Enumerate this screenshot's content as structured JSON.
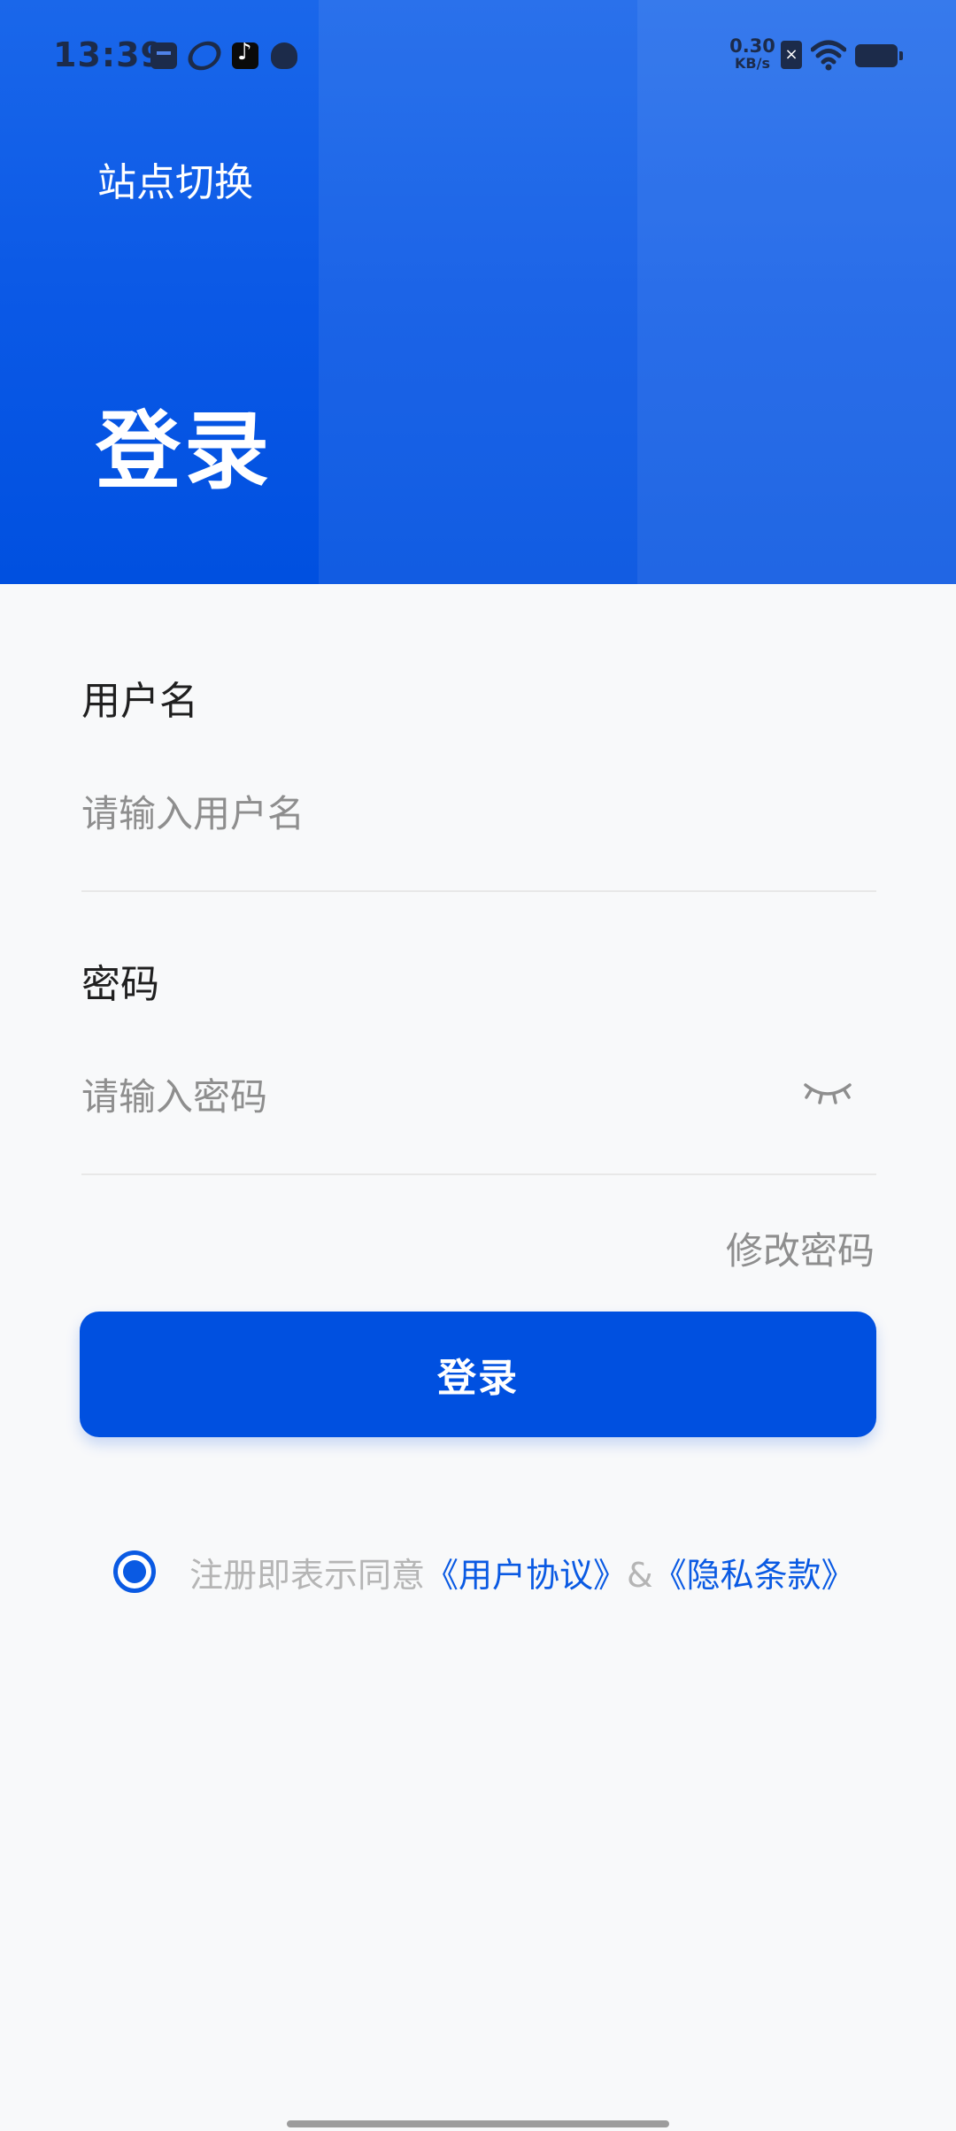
{
  "status_bar": {
    "time": "13:39",
    "net_speed_value": "0.30",
    "net_speed_unit": "KB/s",
    "sim_label": "×",
    "icons": [
      "calendar-app-icon",
      "planet-app-icon",
      "tiktok-app-icon",
      "cat-app-icon",
      "sim-off-icon",
      "wifi-icon",
      "battery-icon"
    ]
  },
  "header": {
    "site_switch_label": "站点切换",
    "title": "登录"
  },
  "form": {
    "username_label": "用户名",
    "username_placeholder": "请输入用户名",
    "username_value": "",
    "password_label": "密码",
    "password_placeholder": "请输入密码",
    "password_value": "",
    "password_toggle_icon": "eye-closed-icon",
    "change_password_label": "修改密码",
    "login_button_label": "登录"
  },
  "agreement": {
    "checked": true,
    "prefix": "注册即表示同意",
    "user_agreement": "《用户协议》",
    "separator": "&",
    "privacy_policy": "《隐私条款》"
  },
  "colors": {
    "primary": "#0050e0",
    "link": "#0a5ae3",
    "placeholder": "#8e8e8e",
    "background": "#f8f9fa"
  }
}
